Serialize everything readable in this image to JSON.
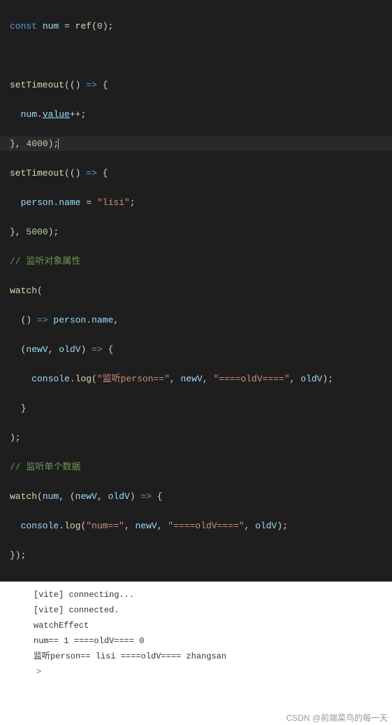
{
  "code": {
    "l1a": "const",
    "l1b": " num ",
    "l1c": "=",
    "l1d": " ref",
    "l1e": "(",
    "l1f": "0",
    "l1g": ");",
    "l3a": "setTimeout",
    "l3b": "(() ",
    "l3c": "=>",
    "l3d": " {",
    "l4a": "  num",
    "l4b": ".",
    "l4c": "value",
    "l4d": "++;",
    "l5a": "}, ",
    "l5b": "4000",
    "l5c": ");",
    "l6a": "setTimeout",
    "l6b": "(() ",
    "l6c": "=>",
    "l6d": " {",
    "l7a": "  person",
    "l7b": ".",
    "l7c": "name",
    "l7d": " = ",
    "l7e": "\"lisi\"",
    "l7f": ";",
    "l8a": "}, ",
    "l8b": "5000",
    "l8c": ");",
    "l9a": "// 监听对象属性",
    "l10a": "watch",
    "l10b": "(",
    "l11a": "  () ",
    "l11b": "=>",
    "l11c": " person",
    "l11d": ".",
    "l11e": "name",
    "l11f": ",",
    "l12a": "  (",
    "l12b": "newV",
    "l12c": ", ",
    "l12d": "oldV",
    "l12e": ") ",
    "l12f": "=>",
    "l12g": " {",
    "l13a": "    console",
    "l13b": ".",
    "l13c": "log",
    "l13d": "(",
    "l13e": "\"监听person==\"",
    "l13f": ", ",
    "l13g": "newV",
    "l13h": ", ",
    "l13i": "\"====oldV====\"",
    "l13j": ", ",
    "l13k": "oldV",
    "l13l": ");",
    "l14a": "  }",
    "l15a": ");",
    "l16a": "// 监听单个数据",
    "l17a": "watch",
    "l17b": "(",
    "l17c": "num",
    "l17d": ", (",
    "l17e": "newV",
    "l17f": ", ",
    "l17g": "oldV",
    "l17h": ") ",
    "l17i": "=>",
    "l17j": " {",
    "l18a": "  console",
    "l18b": ".",
    "l18c": "log",
    "l18d": "(",
    "l18e": "\"num==\"",
    "l18f": ", ",
    "l18g": "newV",
    "l18h": ", ",
    "l18i": "\"====oldV====\"",
    "l18j": ", ",
    "l18k": "oldV",
    "l18l": ");",
    "l19a": "});"
  },
  "console": {
    "r1": "[vite] connecting...",
    "r2": "[vite] connected.",
    "r3": "watchEffect",
    "r4": "num== 1 ====oldV==== 0",
    "r5": "监听person== lisi ====oldV==== zhangsan",
    "prompt": ">"
  },
  "footer": "CSDN @前端菜鸟的每一天"
}
